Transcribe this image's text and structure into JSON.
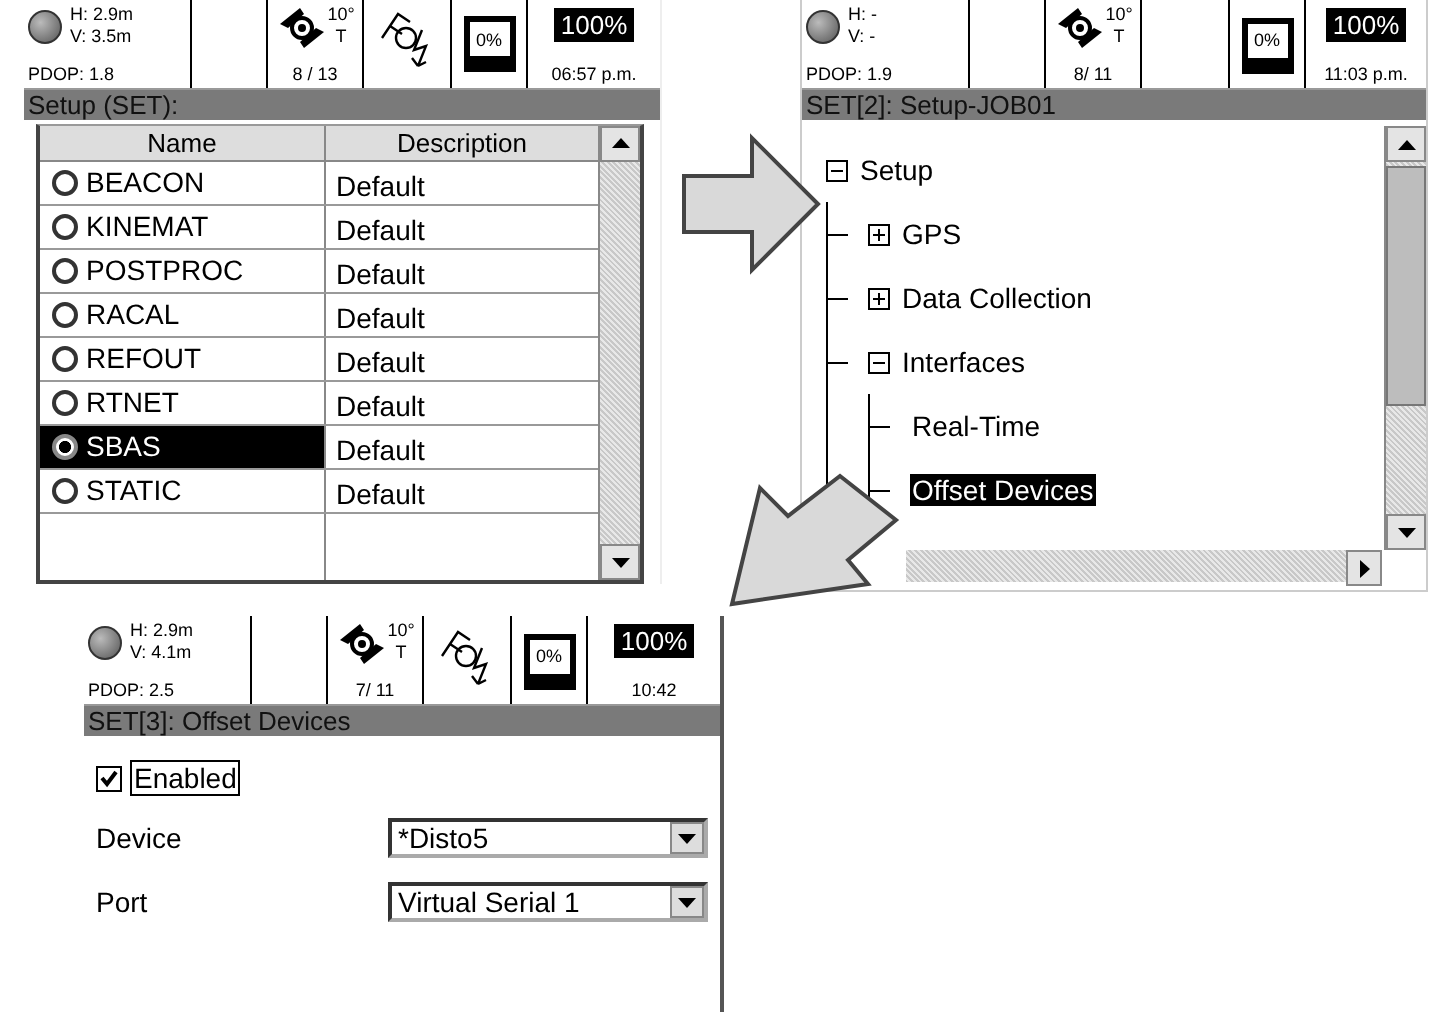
{
  "screens": [
    {
      "kind": "table",
      "status": {
        "h": "H: 2.9m",
        "v": "V: 3.5m",
        "pdop": "PDOP: 1.8",
        "mask": "10°",
        "mask_unit": "T",
        "satellites": "8 / 13",
        "radio_link": true,
        "memory": "0%",
        "battery": "100%",
        "time": "06:57 p.m."
      },
      "title": "Setup (SET):",
      "columns": [
        "Name",
        "Description"
      ],
      "rows": [
        {
          "name": "BEACON",
          "description": "Default",
          "selected": false
        },
        {
          "name": "KINEMAT",
          "description": "Default",
          "selected": false
        },
        {
          "name": "POSTPROC",
          "description": "Default",
          "selected": false
        },
        {
          "name": "RACAL",
          "description": "Default",
          "selected": false
        },
        {
          "name": "REFOUT",
          "description": "Default",
          "selected": false
        },
        {
          "name": "RTNET",
          "description": "Default",
          "selected": false
        },
        {
          "name": "SBAS",
          "description": "Default",
          "selected": true
        },
        {
          "name": "STATIC",
          "description": "Default",
          "selected": false
        }
      ]
    },
    {
      "kind": "tree",
      "status": {
        "h": "H: -",
        "v": "V: -",
        "pdop": "PDOP: 1.9",
        "mask": "10°",
        "mask_unit": "T",
        "satellites": "8/ 11",
        "radio_link": false,
        "memory": "0%",
        "battery": "100%",
        "time": "11:03 p.m."
      },
      "title": "SET[2]: Setup-JOB01",
      "tree": [
        {
          "label": "Setup",
          "expanded": true,
          "selected": false,
          "children": [
            {
              "label": "GPS",
              "expanded": false,
              "selected": false
            },
            {
              "label": "Data Collection",
              "expanded": false,
              "selected": false
            },
            {
              "label": "Interfaces",
              "expanded": true,
              "selected": false,
              "children": [
                {
                  "label": "Real-Time",
                  "selected": false
                },
                {
                  "label": "Offset Devices",
                  "selected": true
                }
              ]
            }
          ]
        }
      ]
    },
    {
      "kind": "form",
      "status": {
        "h": "H: 2.9m",
        "v": "V: 4.1m",
        "pdop": "PDOP: 2.5",
        "mask": "10°",
        "mask_unit": "T",
        "satellites": "7/ 11",
        "radio_link": true,
        "memory": "0%",
        "battery": "100%",
        "time": "10:42"
      },
      "title": "SET[3]: Offset Devices",
      "checkbox": {
        "label": "Enabled",
        "checked": true
      },
      "fields": [
        {
          "label": "Device",
          "value": "*Disto5"
        },
        {
          "label": "Port",
          "value": "Virtual Serial 1"
        }
      ]
    }
  ]
}
